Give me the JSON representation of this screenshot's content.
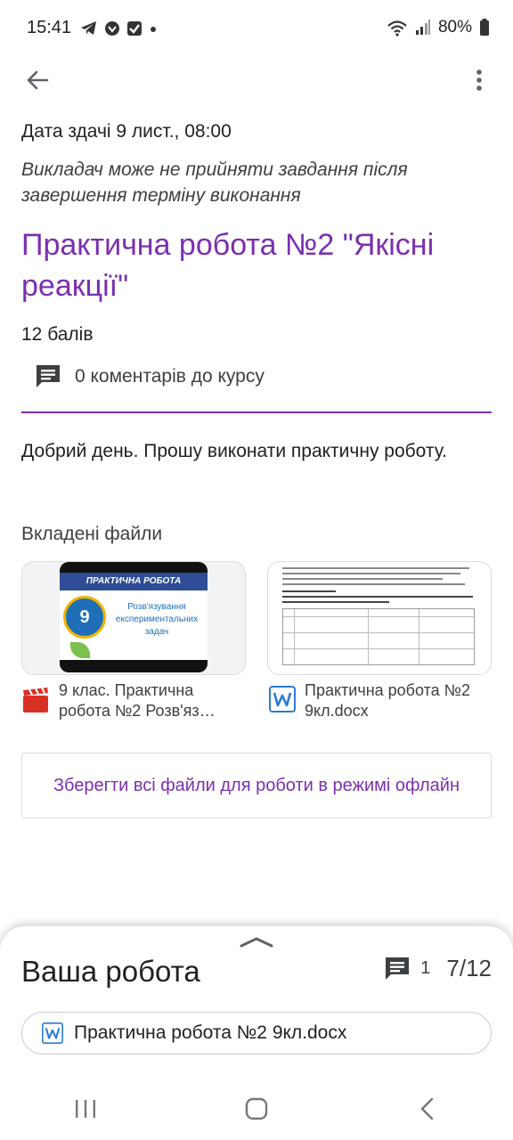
{
  "status_bar": {
    "time": "15:41",
    "battery": "80%",
    "icons": [
      "telegram-icon",
      "viber-icon",
      "checkbox-icon",
      "dot-icon",
      "wifi-icon",
      "signal-icon",
      "battery-icon"
    ]
  },
  "header": {
    "back_icon": "arrow-left-icon",
    "more_icon": "more-vert-icon"
  },
  "assignment": {
    "due": "Дата здачі 9 лист., 08:00",
    "late_note": "Викладач може не прийняти завдання після завершення терміну виконання",
    "title": "Практична робота №2 \"Якісні реакції\"",
    "points": "12 балів",
    "comments": "0 коментарів до курсу",
    "description": "Добрий день. Прошу виконати практичну роботу."
  },
  "attachments": {
    "label": "Вкладені файли",
    "files": [
      {
        "name": "9 клас. Практична робота №2  Розв'яз…",
        "type_icon": "video-clapper-icon",
        "thumb": {
          "header": "ПРАКТИЧНА РОБОТА",
          "number": "9",
          "text": "Розв'язування експериментальних задач"
        }
      },
      {
        "name": "Практична робота №2 9кл.docx",
        "type_icon": "word-doc-icon"
      }
    ],
    "offline_button": "Зберегти всі файли для роботи в режимі офлайн"
  },
  "work_sheet": {
    "title": "Ваша робота",
    "comment_count": "1",
    "grade": "7/12",
    "attachment": "Практична робота №2 9кл.docx"
  },
  "colors": {
    "accent": "#7b2fb0",
    "word_blue": "#2b7cd3",
    "video_red": "#d93025"
  }
}
